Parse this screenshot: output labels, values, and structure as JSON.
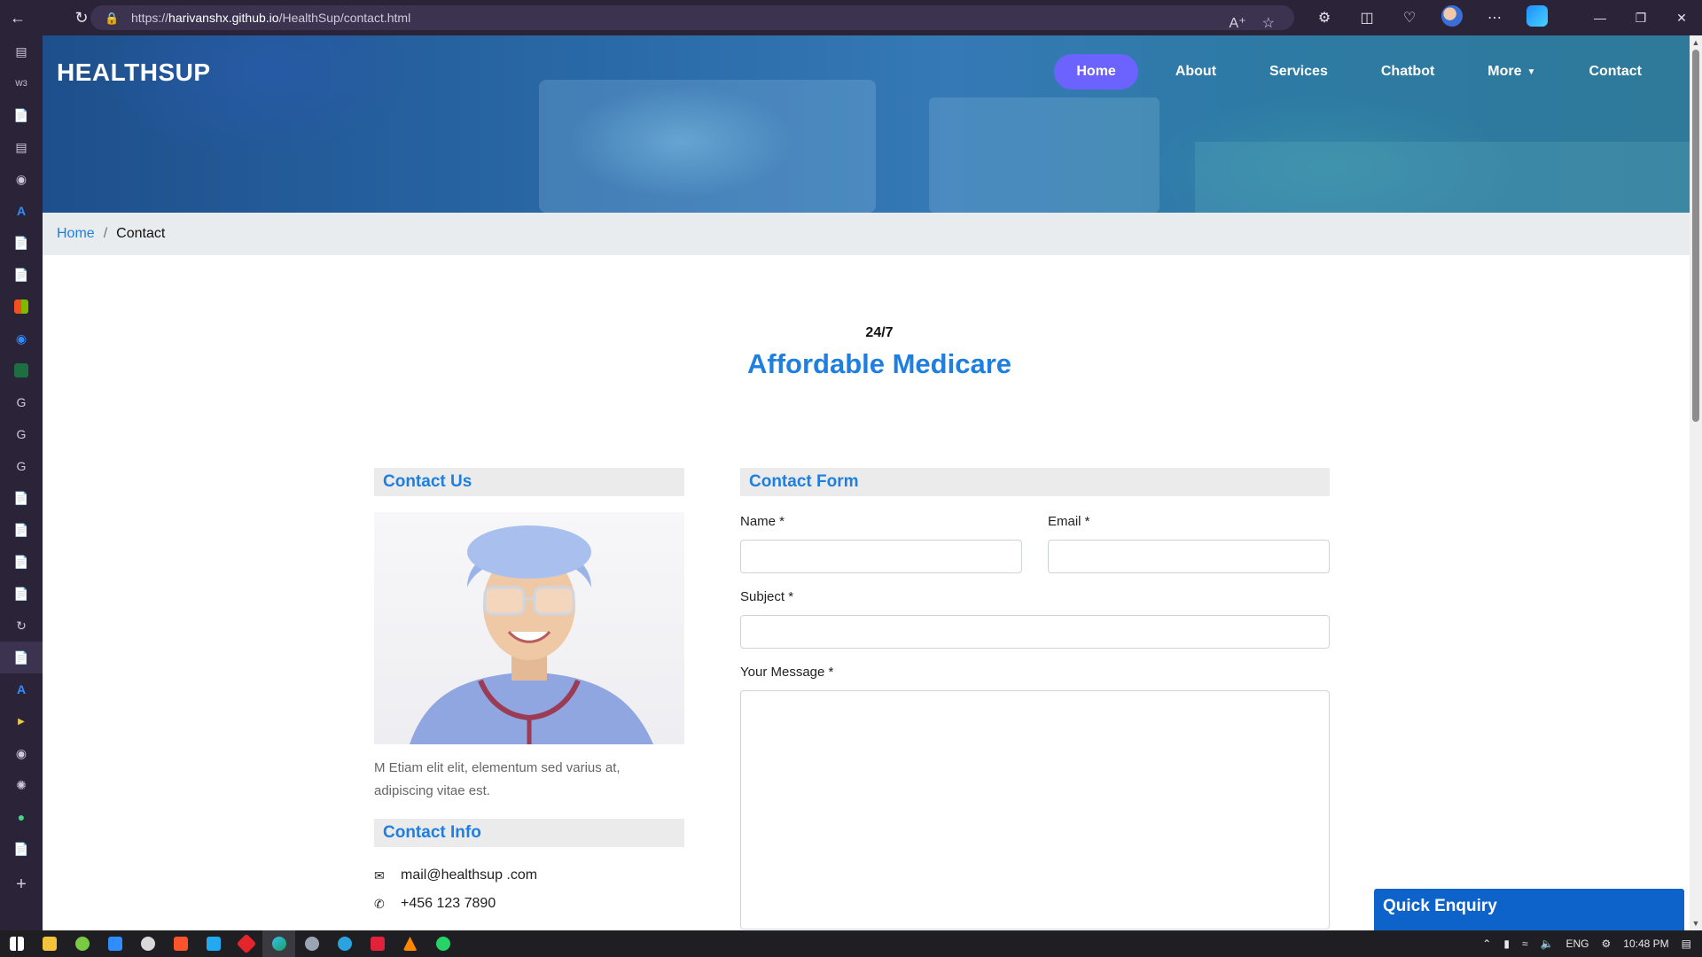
{
  "browser": {
    "url_prefix": "https://",
    "url_host": "harivanshx.github.io",
    "url_path": "/HealthSup/contact.html"
  },
  "site": {
    "brand": "HEALTHSUP",
    "nav": [
      {
        "label": "Home",
        "active": true
      },
      {
        "label": "About"
      },
      {
        "label": "Services"
      },
      {
        "label": "Chatbot"
      },
      {
        "label": "More"
      },
      {
        "label": "Contact"
      }
    ]
  },
  "breadcrumb": {
    "home": "Home",
    "separator": "/",
    "current": "Contact"
  },
  "tagline": {
    "small": "24/7",
    "big": "Affordable Medicare"
  },
  "contact_us": {
    "heading": "Contact Us",
    "lead": "M Etiam elit elit, elementum sed varius at, adipiscing vitae est."
  },
  "contact_info": {
    "heading": "Contact Info",
    "email": "mail@healthsup .com",
    "phone": "+456 123 7890"
  },
  "contact_form": {
    "heading": "Contact Form",
    "name_label": "Name *",
    "email_label": "Email *",
    "subject_label": "Subject *",
    "message_label": "Your Message *"
  },
  "quick_enquiry": {
    "label": "Quick Enquiry"
  },
  "taskbar": {
    "lang": "ENG",
    "time": "10:48 PM"
  },
  "colors": {
    "accent": "#1e7fe0",
    "nav_active": "#6c63ff",
    "enquiry": "#0d63c9"
  }
}
